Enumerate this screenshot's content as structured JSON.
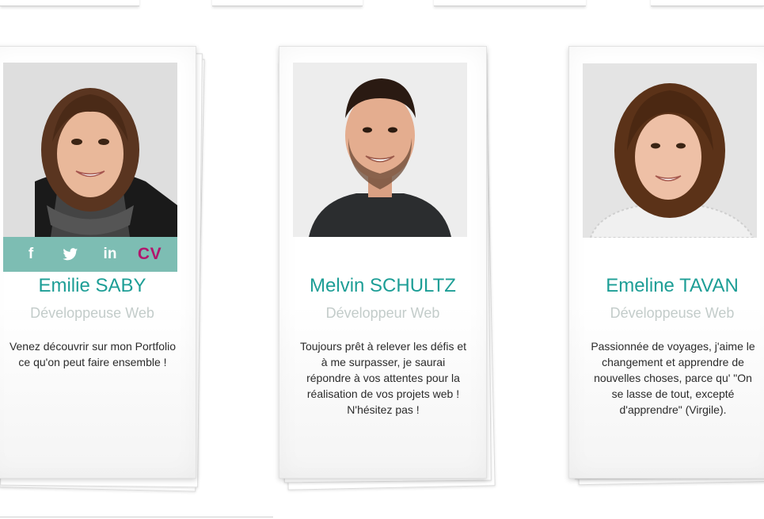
{
  "cards": [
    {
      "name": "Emilie SABY",
      "role": "Développeuse Web",
      "desc_lines": [
        "Venez découvrir sur mon Portfolio",
        "ce qu'on peut faire ensemble !"
      ],
      "social": {
        "facebook": "f",
        "linkedin": "in",
        "cv": "CV"
      }
    },
    {
      "name": "Melvin SCHULTZ",
      "role": "Développeur Web",
      "desc_lines": [
        "Toujours prêt à relever les défis et",
        "à me surpasser, je saurai",
        "répondre à vos attentes pour la",
        "réalisation de vos projets web !",
        "N'hésitez pas !"
      ]
    },
    {
      "name": "Emeline TAVAN",
      "role": "Développeuse Web",
      "desc_lines": [
        "Passionnée de voyages, j'aime le",
        "changement et apprendre de",
        "nouvelles choses, parce qu' \"On",
        "se lasse de tout, excepté",
        "d'apprendre\" (Virgile)."
      ]
    }
  ],
  "colors": {
    "accent_name": "#1d9e96",
    "role_grey": "#c3ccca",
    "social_bar": "#7dbdb3",
    "cv_magenta": "#b1166d"
  },
  "icons": [
    "facebook-icon",
    "twitter-icon",
    "linkedin-icon"
  ]
}
